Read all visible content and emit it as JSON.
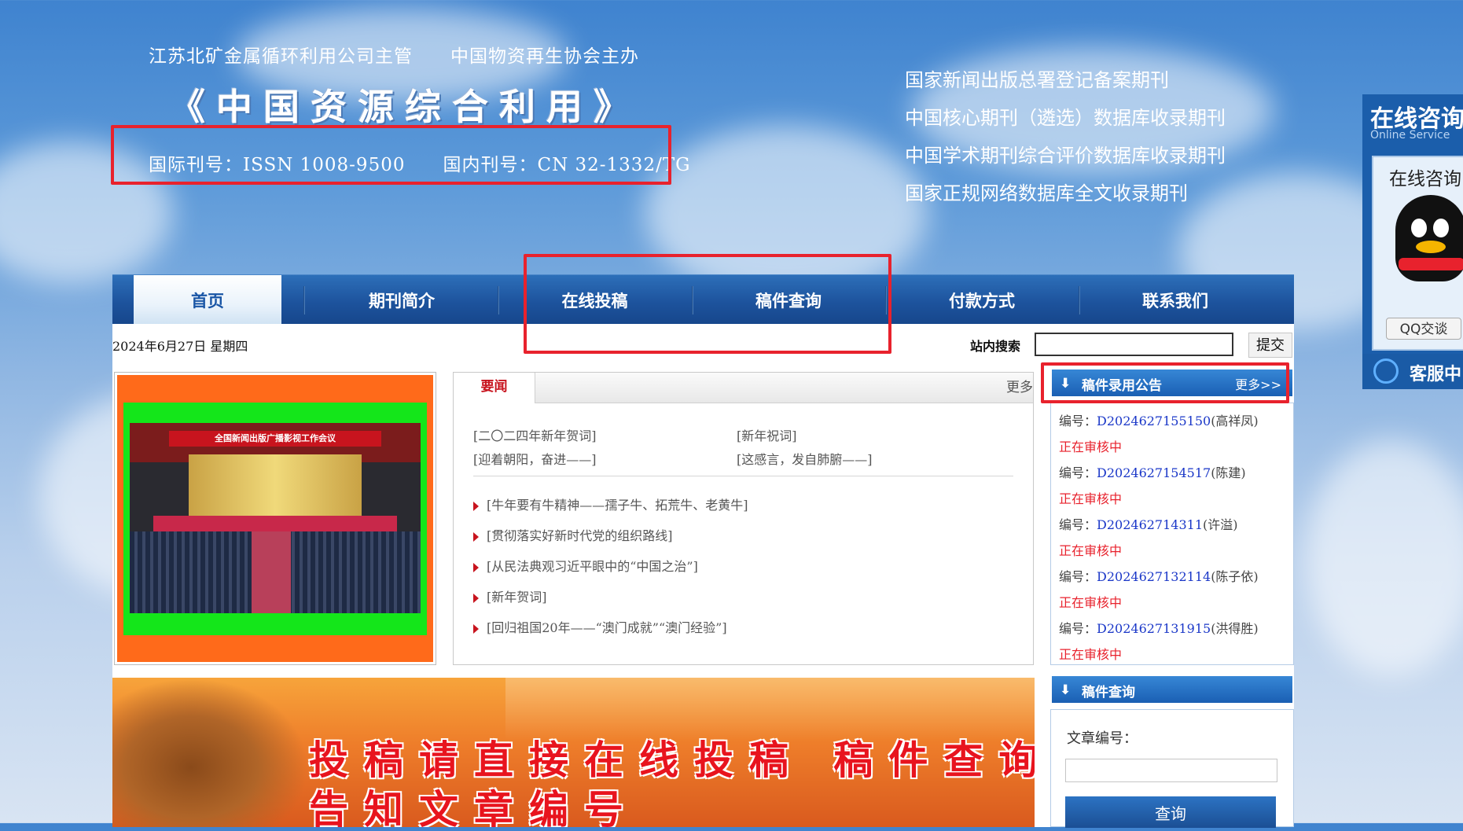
{
  "header": {
    "sponsor": "江苏北矿金属循环利用公司主管　　中国物资再生协会主办",
    "title": "《中国资源综合利用》",
    "issn": "国际刊号：ISSN 1008-9500　　国内刊号：CN 32-1332/TG",
    "right_lines": [
      "国家新闻出版总署登记备案期刊",
      "中国核心期刊（遴选）数据库收录期刊",
      "中国学术期刊综合评价数据库收录期刊",
      "国家正规网络数据库全文收录期刊"
    ]
  },
  "nav": {
    "items": [
      {
        "label": "首页"
      },
      {
        "label": "期刊简介"
      },
      {
        "label": "在线投稿"
      },
      {
        "label": "稿件查询"
      },
      {
        "label": "付款方式"
      },
      {
        "label": "联系我们"
      }
    ]
  },
  "topbar": {
    "date": "2024年6月27日  星期四",
    "search_label": "站内搜索",
    "search_value": "",
    "submit_label": "提交"
  },
  "photo": {
    "caption": "全国新闻出版广播影视工作会议"
  },
  "news": {
    "tab": "要闻",
    "more": "更多",
    "featured": [
      "[二〇二四年新年贺词]",
      "[新年祝词]",
      "[迎着朝阳，奋进——]",
      "[这感言，发自肺腑——]"
    ],
    "items": [
      "[牛年要有牛精神——孺子牛、拓荒牛、老黄牛]",
      "[贯彻落实好新时代党的组织路线]",
      "[从民法典观习近平眼中的“中国之治”]",
      "[新年贺词]",
      "[回归祖国20年——“澳门成就”“澳门经验”]"
    ]
  },
  "notice": {
    "title": "稿件录用公告",
    "more": "更多>>",
    "entries": [
      {
        "prefix": "编号：",
        "code": "D2024627155150",
        "name": "(高祥凤)",
        "status": "正在审核中"
      },
      {
        "prefix": "编号：",
        "code": "D2024627154517",
        "name": "(陈建)",
        "status": "正在审核中"
      },
      {
        "prefix": "编号：",
        "code": "D202462714311",
        "name": "(许溢)",
        "status": "正在审核中"
      },
      {
        "prefix": "编号：",
        "code": "D2024627132114",
        "name": "(陈子依)",
        "status": "正在审核中"
      },
      {
        "prefix": "编号：",
        "code": "D2024627131915",
        "name": "(洪得胜)",
        "status": "正在审核中"
      }
    ]
  },
  "query": {
    "title": "稿件查询",
    "label": "文章编号：",
    "value": "",
    "button": "查询"
  },
  "banner": {
    "line1": "投稿请直接在线投稿  稿件查询请",
    "line2": "告知文章编号"
  },
  "float": {
    "title": "在线咨询",
    "subtitle": "Online Service",
    "inner_title": "在线咨询",
    "qq_button": "QQ交谈",
    "bottom": "客服中"
  },
  "colors": {
    "highlight_box": "#e8222d",
    "nav": "#1d539d",
    "link_code": "#1a37c8",
    "status": "#e8222d"
  }
}
